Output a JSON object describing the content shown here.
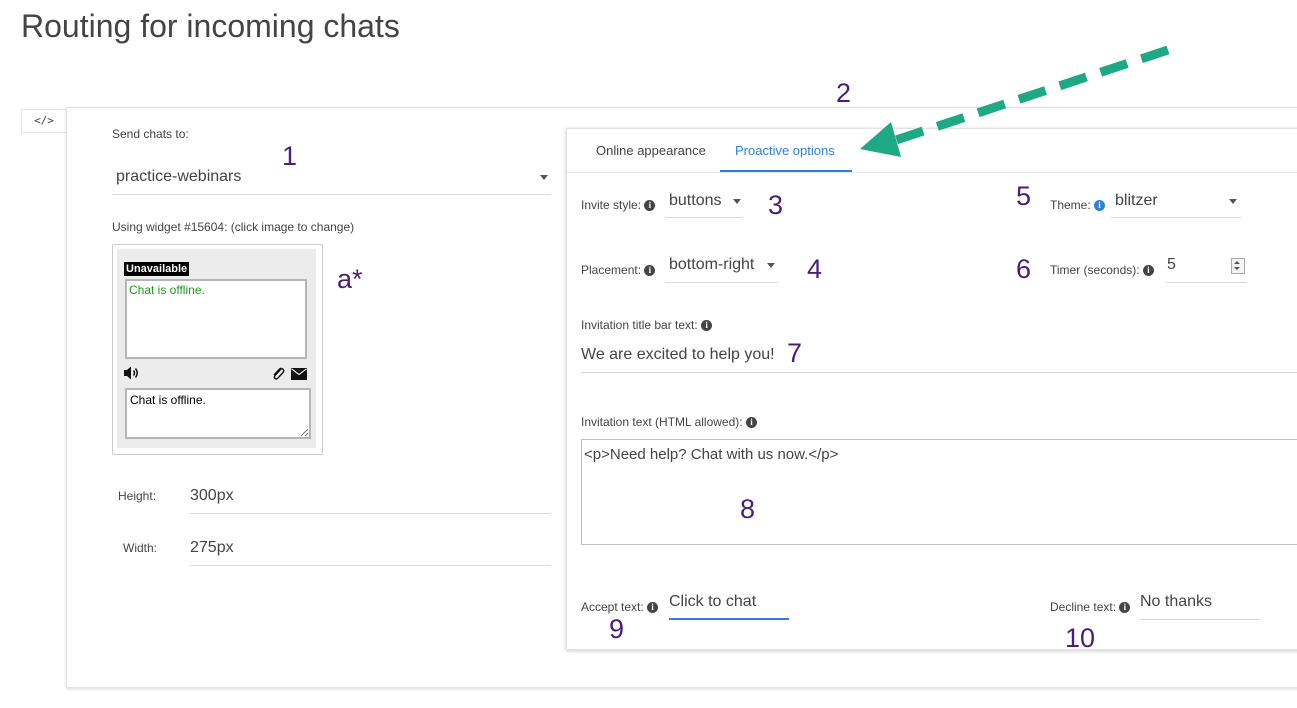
{
  "page_title": "Routing for incoming chats",
  "code_toggle": "</>",
  "send_chats": {
    "label": "Send chats to:",
    "value": "practice-webinars"
  },
  "widget": {
    "label": "Using widget #15604: (click image to change)",
    "status": "Unavailable",
    "log_text": "Chat is offline.",
    "input_text": "Chat is offline."
  },
  "height": {
    "label": "Height:",
    "value": "300px"
  },
  "width": {
    "label": "Width:",
    "value": "275px"
  },
  "tabs": [
    {
      "label": "Online appearance",
      "active": false
    },
    {
      "label": "Proactive options",
      "active": true
    }
  ],
  "invite_style": {
    "label": "Invite style:",
    "value": "buttons"
  },
  "theme": {
    "label": "Theme:",
    "value": "blitzer"
  },
  "placement": {
    "label": "Placement:",
    "value": "bottom-right"
  },
  "timer": {
    "label": "Timer (seconds):",
    "value": "5"
  },
  "title_bar": {
    "label": "Invitation title bar text:",
    "value": "We are excited to help you!"
  },
  "invitation_text": {
    "label": "Invitation text (HTML allowed):",
    "value": "<p>Need help? Chat with us now.</p>"
  },
  "accept": {
    "label": "Accept text:",
    "value": "Click to chat"
  },
  "decline": {
    "label": "Decline text:",
    "value": "No thanks"
  },
  "annotations": {
    "n1": "1",
    "n2": "2",
    "n3": "3",
    "n4": "4",
    "n5": "5",
    "n6": "6",
    "n7": "7",
    "n8": "8",
    "n9": "9",
    "n10": "10",
    "a": "a*"
  },
  "colors": {
    "accent": "#2c82d8",
    "annotation": "#4b1d7a",
    "arrow": "#1fa884"
  }
}
